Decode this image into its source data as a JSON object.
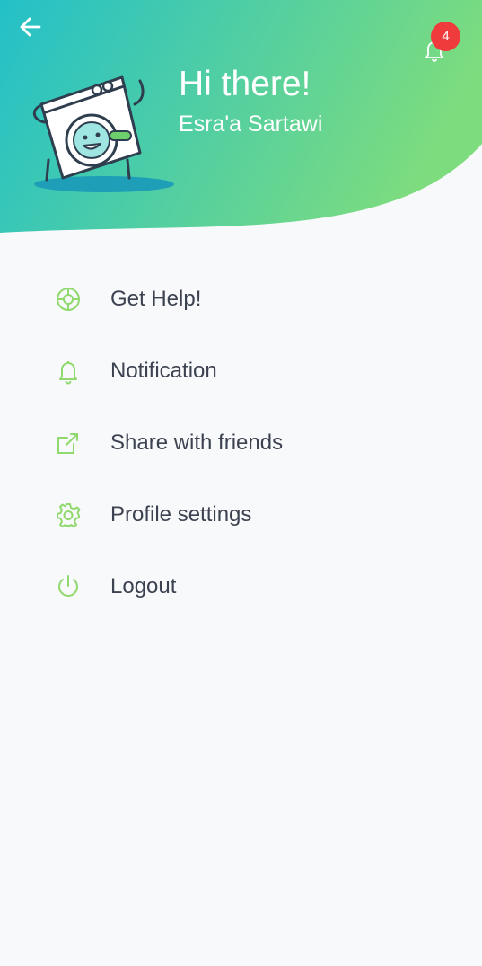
{
  "header": {
    "greeting": "Hi there!",
    "user_name": "Esra'a Sartawi",
    "notification_count": "4",
    "gradient_start": "#23c0c9",
    "gradient_end": "#7ddc7e"
  },
  "menu": {
    "icon_color": "#8fd96e",
    "text_color": "#3c4250",
    "items": [
      {
        "label": "Get Help!",
        "icon": "lifebuoy-icon"
      },
      {
        "label": "Notification",
        "icon": "bell-icon"
      },
      {
        "label": "Share with friends",
        "icon": "share-icon"
      },
      {
        "label": "Profile settings",
        "icon": "gear-icon"
      },
      {
        "label": "Logout",
        "icon": "power-icon"
      }
    ]
  }
}
